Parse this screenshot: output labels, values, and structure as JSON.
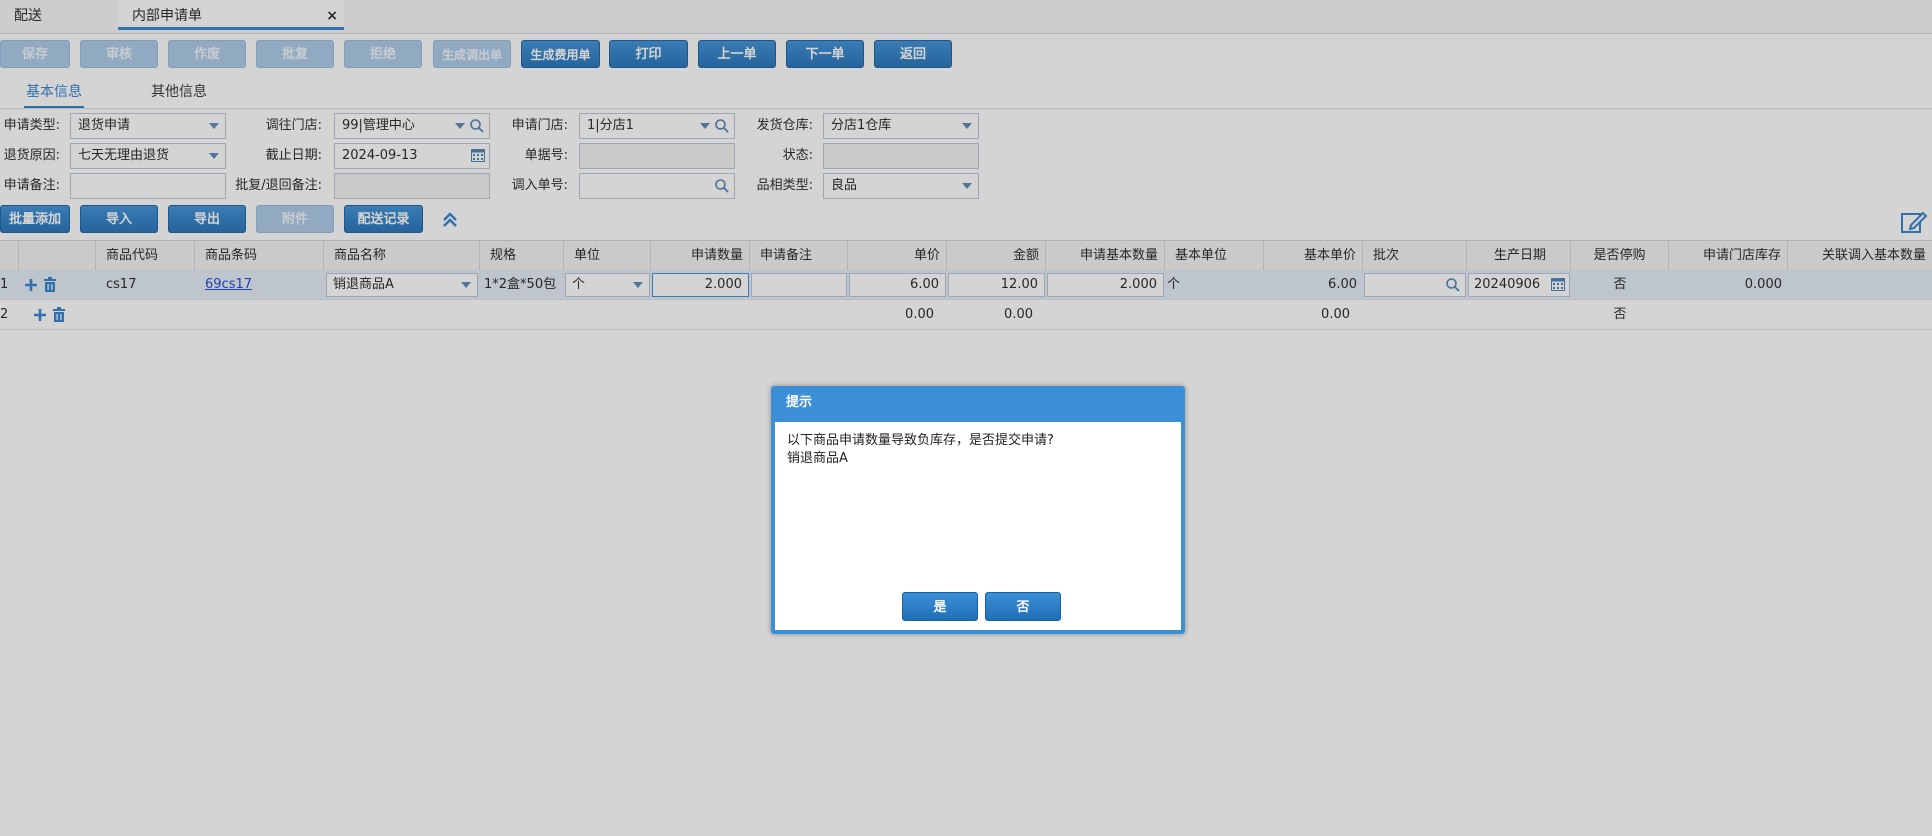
{
  "tabs": [
    {
      "label": "配送"
    },
    {
      "label": "内部申请单",
      "close": "×"
    }
  ],
  "toolbar": {
    "buttons": [
      {
        "label": "保存",
        "disabled": true
      },
      {
        "label": "审核",
        "disabled": true
      },
      {
        "label": "作废",
        "disabled": true
      },
      {
        "label": "批复",
        "disabled": true
      },
      {
        "label": "拒绝",
        "disabled": true
      },
      {
        "label": "生成调出单",
        "disabled": true
      },
      {
        "label": "生成费用单",
        "disabled": false
      },
      {
        "label": "打印",
        "disabled": false
      },
      {
        "label": "上一单",
        "disabled": false
      },
      {
        "label": "下一单",
        "disabled": false
      },
      {
        "label": "返回",
        "disabled": false
      }
    ]
  },
  "subtabs": [
    {
      "label": "基本信息",
      "active": true
    },
    {
      "label": "其他信息",
      "active": false
    }
  ],
  "form": {
    "apply_type_label": "申请类型:",
    "apply_type_value": "退货申请",
    "to_store_label": "调往门店:",
    "to_store_value": "99|管理中心",
    "apply_store_label": "申请门店:",
    "apply_store_value": "1|分店1",
    "warehouse_label": "发货仓库:",
    "warehouse_value": "分店1仓库",
    "return_reason_label": "退货原因:",
    "return_reason_value": "七天无理由退货",
    "deadline_label": "截止日期:",
    "deadline_value": "2024-09-13",
    "doc_no_label": "单据号:",
    "doc_no_value": "",
    "status_label": "状态:",
    "status_value": "",
    "apply_remark_label": "申请备注:",
    "apply_remark_value": "",
    "reply_remark_label": "批复/退回备注:",
    "reply_remark_value": "",
    "in_no_label": "调入单号:",
    "in_no_value": "",
    "quality_label": "品相类型:",
    "quality_value": "良品"
  },
  "actions": {
    "buttons": [
      {
        "label": "批量添加",
        "disabled": false
      },
      {
        "label": "导入",
        "disabled": false
      },
      {
        "label": "导出",
        "disabled": false
      },
      {
        "label": "附件",
        "disabled": true
      },
      {
        "label": "配送记录",
        "disabled": false
      }
    ]
  },
  "grid": {
    "headers": [
      "商品代码",
      "商品条码",
      "商品名称",
      "规格",
      "单位",
      "申请数量",
      "申请备注",
      "单价",
      "金额",
      "申请基本数量",
      "基本单位",
      "基本单价",
      "批次",
      "生产日期",
      "是否停购",
      "申请门店库存",
      "关联调入基本数量"
    ],
    "rows": [
      {
        "no": "1",
        "code": "cs17",
        "barcode": "69cs17",
        "name": "销退商品A",
        "spec": "1*2盒*50包",
        "unit": "个",
        "qty": "2.000",
        "remark": "",
        "price": "6.00",
        "amount": "12.00",
        "base_qty": "2.000",
        "base_unit": "个",
        "base_price": "6.00",
        "batch": "",
        "prod_date": "20240906",
        "stop": "否",
        "stock": "0.000",
        "linked": ""
      },
      {
        "no": "2",
        "price": "0.00",
        "amount": "0.00",
        "base_price": "0.00",
        "stop": "否"
      }
    ]
  },
  "dialog": {
    "title": "提示",
    "message_line1": "以下商品申请数量导致负库存，是否提交申请?",
    "message_line2": "销退商品A",
    "yes_label": "是",
    "no_label": "否"
  },
  "colors": {
    "accent": "#2e86d4",
    "button": "#1f6fb8",
    "dialog": "#3a8fd6"
  }
}
